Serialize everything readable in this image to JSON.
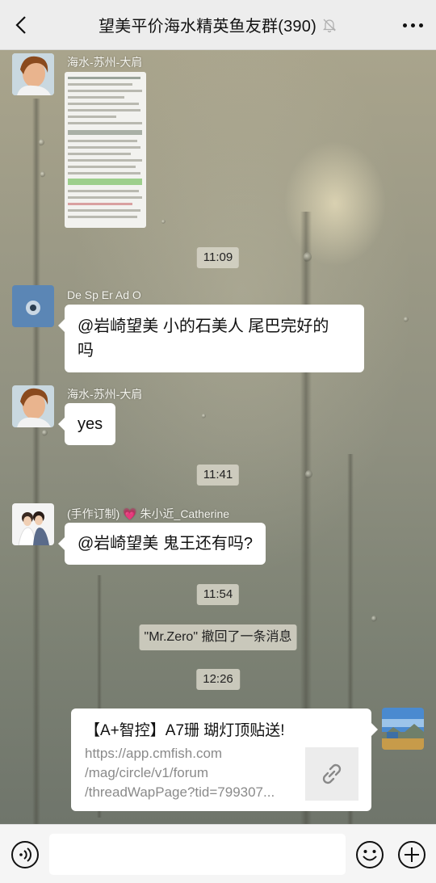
{
  "header": {
    "title": "望美平价海水精英鱼友群(390)",
    "back_icon": "chevron-left-icon",
    "mute_icon": "bell-off-icon",
    "more_icon": "more-dots-icon"
  },
  "messages": [
    {
      "type": "image",
      "sender": "海水-苏州-大肩",
      "avatar": "avatar-portrait-man"
    },
    {
      "type": "time",
      "text": "11:09"
    },
    {
      "type": "text",
      "sender": "De Sp Er Ad O",
      "text_line1": "@岩崎望美  小的石美人 尾巴完好的",
      "text_line2": "吗"
    },
    {
      "type": "text",
      "sender": "海水-苏州-大肩",
      "text": "yes"
    },
    {
      "type": "time",
      "text": "11:41"
    },
    {
      "type": "text",
      "sender": "(手作订制) 💗 朱小近_Catherine",
      "text": "@岩崎望美  鬼王还有吗?"
    },
    {
      "type": "time",
      "text": "11:54"
    },
    {
      "type": "system",
      "text": "\"Mr.Zero\" 撤回了一条消息"
    },
    {
      "type": "time",
      "text": "12:26"
    },
    {
      "type": "link",
      "from_self": true,
      "title": "【A+智控】A7珊 瑚灯顶贴送!",
      "url_line1": "https://app.cmfish.com",
      "url_line2": "/mag/circle/v1/forum",
      "url_line3": "/threadWapPage?tid=799307...",
      "thumb_icon": "link-icon"
    }
  ],
  "input_bar": {
    "voice_icon": "voice-icon",
    "emoji_icon": "emoji-icon",
    "plus_icon": "plus-icon",
    "input_value": ""
  }
}
